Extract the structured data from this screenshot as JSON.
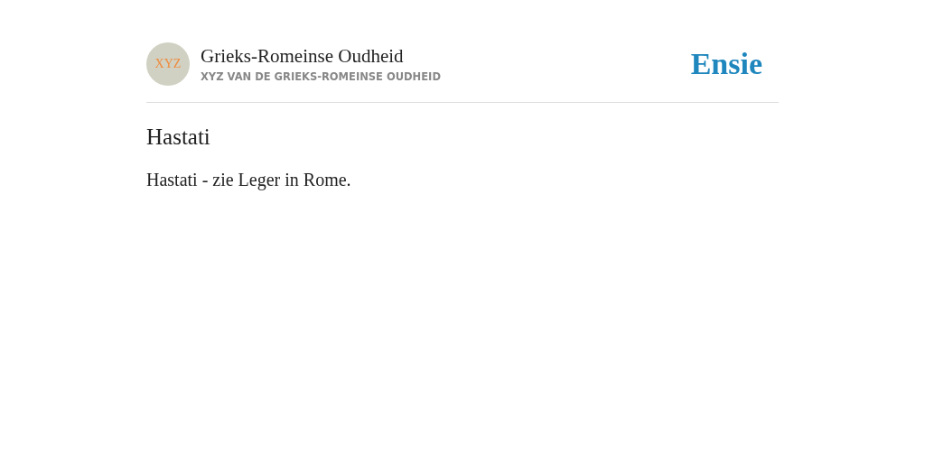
{
  "header": {
    "avatar": "XYZ",
    "title": "Grieks-Romeinse Oudheid",
    "subtitle": "XYZ VAN DE GRIEKS-ROMEINSE OUDHEID",
    "logo": "Ensie"
  },
  "article": {
    "title": "Hastati",
    "body": "Hastati - zie Leger in Rome."
  }
}
